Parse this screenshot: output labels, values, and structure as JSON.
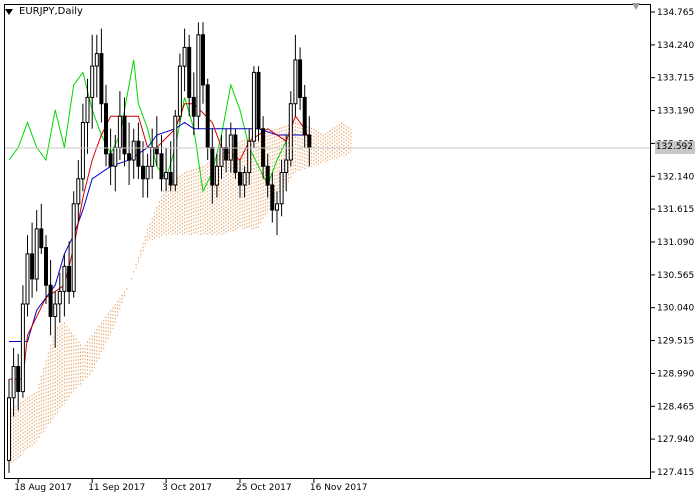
{
  "title": "EURJPY,Daily",
  "current_price": "132.592",
  "colors": {
    "background": "#ffffff",
    "axis": "#000000",
    "candle": "#000000",
    "tenkan": "#d10000",
    "kijun": "#0000c8",
    "chikou": "#00d800",
    "cloud": "#e8a060",
    "price_line": "#c8c8c8"
  },
  "icons": {
    "symbol_menu": "triangle-down-icon",
    "chart_shift": "triangle-down-icon"
  },
  "chart_data": {
    "type": "candlestick",
    "indicator": "Ichimoku Kinko Hyo",
    "ylim": [
      127.415,
      134.765
    ],
    "y_ticks": [
      "134.765",
      "134.240",
      "133.715",
      "133.190",
      "132.665",
      "132.140",
      "131.615",
      "131.090",
      "130.565",
      "130.040",
      "129.515",
      "128.990",
      "128.465",
      "127.940",
      "127.415"
    ],
    "x_labels": [
      {
        "label": "18 Aug 2017",
        "bar": 2
      },
      {
        "label": "11 Sep 2017",
        "bar": 18
      },
      {
        "label": "3 Oct 2017",
        "bar": 34
      },
      {
        "label": "25 Oct 2017",
        "bar": 50
      },
      {
        "label": "16 Nov 2017",
        "bar": 66
      }
    ],
    "candles": [
      [
        127.6,
        128.9,
        127.4,
        128.6
      ],
      [
        128.6,
        129.4,
        128.3,
        129.1
      ],
      [
        129.1,
        129.3,
        128.4,
        128.7
      ],
      [
        128.7,
        130.4,
        128.6,
        130.1
      ],
      [
        130.1,
        131.2,
        129.9,
        130.9
      ],
      [
        130.9,
        131.4,
        130.2,
        130.5
      ],
      [
        130.5,
        131.6,
        130.3,
        131.3
      ],
      [
        131.3,
        131.7,
        130.9,
        131.0
      ],
      [
        131.0,
        131.2,
        130.1,
        130.4
      ],
      [
        130.4,
        130.8,
        129.6,
        129.9
      ],
      [
        129.9,
        130.3,
        129.4,
        130.1
      ],
      [
        130.1,
        130.6,
        129.8,
        130.3
      ],
      [
        130.3,
        130.9,
        129.9,
        130.7
      ],
      [
        130.7,
        131.1,
        130.1,
        130.3
      ],
      [
        130.3,
        131.9,
        130.2,
        131.7
      ],
      [
        131.7,
        132.4,
        131.4,
        132.1
      ],
      [
        132.1,
        133.3,
        131.9,
        133.0
      ],
      [
        133.0,
        133.7,
        132.5,
        133.4
      ],
      [
        133.4,
        134.4,
        132.9,
        133.9
      ],
      [
        133.9,
        134.4,
        133.4,
        134.1
      ],
      [
        134.1,
        134.5,
        133.0,
        133.3
      ],
      [
        133.3,
        133.6,
        132.3,
        132.5
      ],
      [
        132.5,
        132.9,
        132.0,
        132.3
      ],
      [
        132.3,
        132.8,
        131.9,
        132.6
      ],
      [
        132.6,
        133.5,
        132.4,
        133.1
      ],
      [
        133.1,
        133.4,
        132.3,
        132.5
      ],
      [
        132.5,
        133.0,
        132.0,
        132.4
      ],
      [
        132.4,
        132.9,
        132.1,
        132.7
      ],
      [
        132.7,
        133.0,
        132.1,
        132.3
      ],
      [
        132.3,
        132.7,
        131.8,
        132.1
      ],
      [
        132.1,
        132.5,
        131.8,
        132.3
      ],
      [
        132.3,
        132.9,
        132.1,
        132.6
      ],
      [
        132.6,
        133.1,
        132.3,
        132.5
      ],
      [
        132.5,
        132.8,
        131.9,
        132.1
      ],
      [
        132.1,
        132.6,
        131.9,
        132.2
      ],
      [
        132.2,
        132.7,
        131.9,
        132.0
      ],
      [
        132.0,
        133.2,
        131.9,
        133.1
      ],
      [
        133.1,
        134.1,
        133.0,
        133.9
      ],
      [
        133.9,
        134.5,
        133.5,
        134.2
      ],
      [
        134.2,
        134.4,
        133.1,
        133.4
      ],
      [
        133.4,
        133.8,
        132.8,
        133.1
      ],
      [
        133.1,
        134.6,
        132.9,
        134.4
      ],
      [
        134.4,
        134.6,
        133.3,
        133.6
      ],
      [
        133.6,
        133.7,
        132.4,
        132.6
      ],
      [
        132.6,
        132.9,
        131.7,
        132.0
      ],
      [
        132.0,
        132.5,
        131.8,
        132.3
      ],
      [
        132.3,
        132.8,
        132.1,
        132.6
      ],
      [
        132.6,
        132.9,
        132.2,
        132.4
      ],
      [
        132.4,
        133.0,
        132.2,
        132.8
      ],
      [
        132.8,
        132.9,
        132.1,
        132.2
      ],
      [
        132.2,
        132.4,
        131.8,
        132.0
      ],
      [
        132.0,
        132.3,
        131.8,
        132.2
      ],
      [
        132.2,
        132.9,
        132.0,
        132.7
      ],
      [
        132.7,
        133.9,
        132.6,
        133.8
      ],
      [
        133.8,
        133.9,
        132.7,
        132.9
      ],
      [
        132.9,
        133.1,
        132.1,
        132.3
      ],
      [
        132.3,
        132.5,
        131.8,
        132.0
      ],
      [
        132.0,
        132.2,
        131.4,
        131.6
      ],
      [
        131.6,
        131.9,
        131.2,
        131.7
      ],
      [
        131.7,
        132.4,
        131.5,
        132.2
      ],
      [
        132.2,
        132.8,
        131.9,
        132.4
      ],
      [
        132.4,
        133.5,
        132.3,
        133.3
      ],
      [
        133.3,
        134.4,
        133.1,
        134.0
      ],
      [
        134.0,
        134.2,
        133.2,
        133.4
      ],
      [
        133.4,
        133.6,
        132.6,
        132.8
      ],
      [
        132.8,
        133.1,
        132.3,
        132.6
      ]
    ],
    "tenkan_sen": [
      [
        0,
        128.9
      ],
      [
        3,
        128.9
      ],
      [
        4,
        129.6
      ],
      [
        8,
        130.2
      ],
      [
        12,
        130.4
      ],
      [
        14,
        131.0
      ],
      [
        16,
        131.8
      ],
      [
        18,
        132.4
      ],
      [
        20,
        132.8
      ],
      [
        22,
        133.1
      ],
      [
        28,
        133.1
      ],
      [
        30,
        132.6
      ],
      [
        32,
        132.6
      ],
      [
        36,
        132.9
      ],
      [
        38,
        133.3
      ],
      [
        40,
        133.3
      ],
      [
        44,
        133.0
      ],
      [
        46,
        132.6
      ],
      [
        50,
        132.4
      ],
      [
        52,
        132.7
      ],
      [
        56,
        132.9
      ],
      [
        60,
        132.7
      ],
      [
        62,
        133.1
      ],
      [
        64,
        132.9
      ],
      [
        65,
        132.7
      ]
    ],
    "kijun_sen": [
      [
        0,
        129.5
      ],
      [
        4,
        129.5
      ],
      [
        6,
        130.0
      ],
      [
        10,
        130.4
      ],
      [
        12,
        130.9
      ],
      [
        14,
        131.2
      ],
      [
        16,
        131.6
      ],
      [
        18,
        132.1
      ],
      [
        22,
        132.3
      ],
      [
        26,
        132.4
      ],
      [
        30,
        132.6
      ],
      [
        32,
        132.8
      ],
      [
        36,
        132.9
      ],
      [
        38,
        133.0
      ],
      [
        40,
        132.9
      ],
      [
        46,
        132.9
      ],
      [
        50,
        132.9
      ],
      [
        54,
        132.9
      ],
      [
        58,
        132.8
      ],
      [
        62,
        132.8
      ],
      [
        65,
        132.8
      ]
    ],
    "chikou_span": [
      [
        0,
        132.4
      ],
      [
        2,
        132.6
      ],
      [
        4,
        133.0
      ],
      [
        6,
        132.6
      ],
      [
        8,
        132.4
      ],
      [
        10,
        133.2
      ],
      [
        12,
        132.6
      ],
      [
        14,
        133.6
      ],
      [
        16,
        133.8
      ],
      [
        18,
        133.2
      ],
      [
        20,
        132.8
      ],
      [
        22,
        132.5
      ],
      [
        24,
        132.8
      ],
      [
        26,
        133.6
      ],
      [
        27,
        134.0
      ],
      [
        28,
        133.3
      ],
      [
        30,
        132.9
      ],
      [
        32,
        132.3
      ],
      [
        34,
        132.1
      ],
      [
        36,
        132.6
      ],
      [
        38,
        133.4
      ],
      [
        40,
        132.9
      ],
      [
        42,
        131.9
      ],
      [
        44,
        132.2
      ],
      [
        46,
        132.8
      ],
      [
        48,
        133.6
      ],
      [
        50,
        133.2
      ],
      [
        52,
        132.6
      ],
      [
        54,
        132.3
      ],
      [
        56,
        132.0
      ],
      [
        58,
        132.4
      ],
      [
        60,
        132.7
      ]
    ],
    "senkou_span_a": [
      [
        0,
        128.4
      ],
      [
        6,
        128.7
      ],
      [
        10,
        129.7
      ],
      [
        12,
        129.8
      ],
      [
        16,
        129.4
      ],
      [
        18,
        129.6
      ],
      [
        22,
        130.0
      ],
      [
        26,
        130.4
      ],
      [
        30,
        131.3
      ],
      [
        34,
        132.0
      ],
      [
        38,
        132.2
      ],
      [
        42,
        132.3
      ],
      [
        46,
        132.5
      ],
      [
        50,
        132.7
      ],
      [
        54,
        132.8
      ],
      [
        58,
        132.9
      ],
      [
        62,
        133.0
      ],
      [
        66,
        132.9
      ],
      [
        68,
        132.8
      ],
      [
        70,
        132.9
      ],
      [
        72,
        133.0
      ],
      [
        74,
        132.9
      ]
    ],
    "senkou_span_b": [
      [
        0,
        127.5
      ],
      [
        6,
        127.9
      ],
      [
        10,
        128.3
      ],
      [
        14,
        128.7
      ],
      [
        18,
        129.0
      ],
      [
        22,
        129.6
      ],
      [
        26,
        130.4
      ],
      [
        30,
        131.1
      ],
      [
        34,
        131.2
      ],
      [
        38,
        131.2
      ],
      [
        42,
        131.2
      ],
      [
        46,
        131.2
      ],
      [
        50,
        131.3
      ],
      [
        54,
        131.3
      ],
      [
        58,
        131.8
      ],
      [
        62,
        132.2
      ],
      [
        66,
        132.3
      ],
      [
        70,
        132.4
      ],
      [
        74,
        132.5
      ]
    ],
    "grid": false,
    "legend": "none"
  }
}
